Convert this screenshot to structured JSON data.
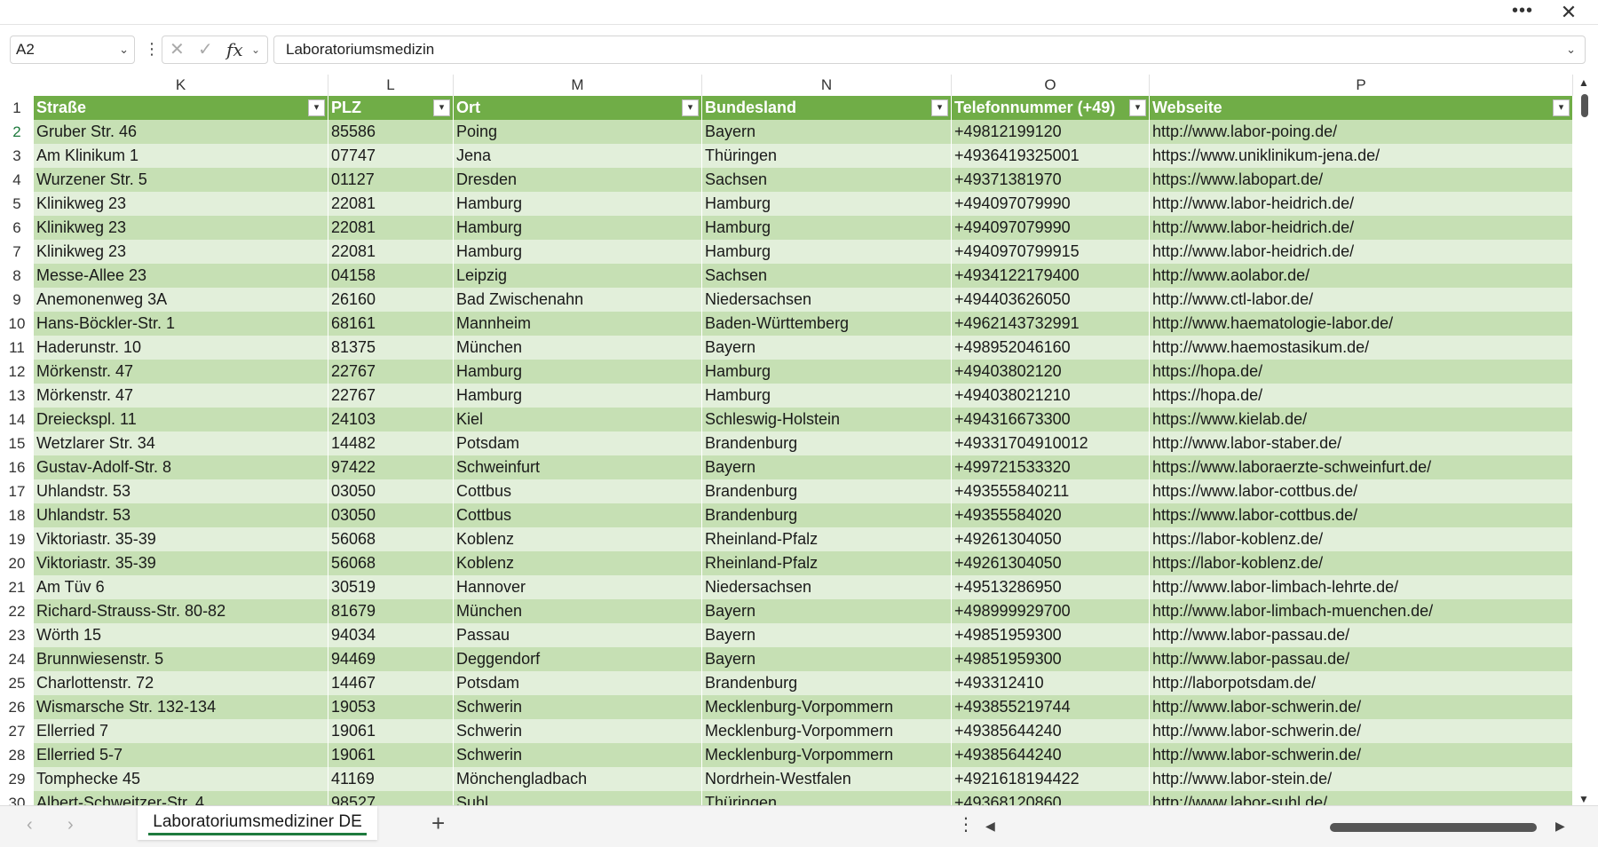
{
  "window": {
    "more_label": "•••",
    "close_label": "✕"
  },
  "formula_bar": {
    "name_box": "A2",
    "dots": "⋮",
    "cancel_icon": "✕",
    "enter_icon": "✓",
    "fx_label": "fx",
    "content": "Laboratoriumsmedizin"
  },
  "columns": [
    "K",
    "L",
    "M",
    "N",
    "O",
    "P"
  ],
  "header_row": {
    "number": "1",
    "cells": [
      "Straße",
      "PLZ",
      "Ort",
      "Bundesland",
      "Telefonnummer (+49)",
      "Webseite"
    ]
  },
  "rows": [
    {
      "n": "2",
      "cells": [
        "Gruber Str. 46",
        "85586",
        "Poing",
        "Bayern",
        "+49812199120",
        "http://www.labor-poing.de/"
      ]
    },
    {
      "n": "3",
      "cells": [
        "Am Klinikum 1",
        "07747",
        "Jena",
        "Thüringen",
        "+4936419325001",
        "https://www.uniklinikum-jena.de/"
      ]
    },
    {
      "n": "4",
      "cells": [
        "Wurzener Str. 5",
        "01127",
        "Dresden",
        "Sachsen",
        "+49371381970",
        "https://www.labopart.de/"
      ]
    },
    {
      "n": "5",
      "cells": [
        "Klinikweg 23",
        "22081",
        "Hamburg",
        "Hamburg",
        "+494097079990",
        "http://www.labor-heidrich.de/"
      ]
    },
    {
      "n": "6",
      "cells": [
        "Klinikweg 23",
        "22081",
        "Hamburg",
        "Hamburg",
        "+494097079990",
        "http://www.labor-heidrich.de/"
      ]
    },
    {
      "n": "7",
      "cells": [
        "Klinikweg 23",
        "22081",
        "Hamburg",
        "Hamburg",
        "+4940970799915",
        "http://www.labor-heidrich.de/"
      ]
    },
    {
      "n": "8",
      "cells": [
        "Messe-Allee 23",
        "04158",
        "Leipzig",
        "Sachsen",
        "+4934122179400",
        "http://www.aolabor.de/"
      ]
    },
    {
      "n": "9",
      "cells": [
        "Anemonenweg 3A",
        "26160",
        "Bad Zwischenahn",
        "Niedersachsen",
        "+494403626050",
        "http://www.ctl-labor.de/"
      ]
    },
    {
      "n": "10",
      "cells": [
        "Hans-Böckler-Str. 1",
        "68161",
        "Mannheim",
        "Baden-Württemberg",
        "+4962143732991",
        "http://www.haematologie-labor.de/"
      ]
    },
    {
      "n": "11",
      "cells": [
        "Haderunstr. 10",
        "81375",
        "München",
        "Bayern",
        "+498952046160",
        "http://www.haemostasikum.de/"
      ]
    },
    {
      "n": "12",
      "cells": [
        "Mörkenstr. 47",
        "22767",
        "Hamburg",
        "Hamburg",
        "+49403802120",
        "https://hopa.de/"
      ]
    },
    {
      "n": "13",
      "cells": [
        "Mörkenstr. 47",
        "22767",
        "Hamburg",
        "Hamburg",
        "+494038021210",
        "https://hopa.de/"
      ]
    },
    {
      "n": "14",
      "cells": [
        "Dreieckspl. 11",
        "24103",
        "Kiel",
        "Schleswig-Holstein",
        "+494316673300",
        "https://www.kielab.de/"
      ]
    },
    {
      "n": "15",
      "cells": [
        "Wetzlarer Str. 34",
        "14482",
        "Potsdam",
        "Brandenburg",
        "+49331704910012",
        "http://www.labor-staber.de/"
      ]
    },
    {
      "n": "16",
      "cells": [
        "Gustav-Adolf-Str. 8",
        "97422",
        "Schweinfurt",
        "Bayern",
        "+499721533320",
        "https://www.laboraerzte-schweinfurt.de/"
      ]
    },
    {
      "n": "17",
      "cells": [
        "Uhlandstr. 53",
        "03050",
        "Cottbus",
        "Brandenburg",
        "+493555840211",
        "https://www.labor-cottbus.de/"
      ]
    },
    {
      "n": "18",
      "cells": [
        "Uhlandstr. 53",
        "03050",
        "Cottbus",
        "Brandenburg",
        "+49355584020",
        "https://www.labor-cottbus.de/"
      ]
    },
    {
      "n": "19",
      "cells": [
        "Viktoriastr. 35-39",
        "56068",
        "Koblenz",
        "Rheinland-Pfalz",
        "+49261304050",
        "https://labor-koblenz.de/"
      ]
    },
    {
      "n": "20",
      "cells": [
        "Viktoriastr. 35-39",
        "56068",
        "Koblenz",
        "Rheinland-Pfalz",
        "+49261304050",
        "https://labor-koblenz.de/"
      ]
    },
    {
      "n": "21",
      "cells": [
        "Am Tüv 6",
        "30519",
        "Hannover",
        "Niedersachsen",
        "+49513286950",
        "http://www.labor-limbach-lehrte.de/"
      ]
    },
    {
      "n": "22",
      "cells": [
        "Richard-Strauss-Str. 80-82",
        "81679",
        "München",
        "Bayern",
        "+498999929700",
        "http://www.labor-limbach-muenchen.de/"
      ]
    },
    {
      "n": "23",
      "cells": [
        "Wörth 15",
        "94034",
        "Passau",
        "Bayern",
        "+49851959300",
        "http://www.labor-passau.de/"
      ]
    },
    {
      "n": "24",
      "cells": [
        "Brunnwiesenstr. 5",
        "94469",
        "Deggendorf",
        "Bayern",
        "+49851959300",
        "http://www.labor-passau.de/"
      ]
    },
    {
      "n": "25",
      "cells": [
        "Charlottenstr. 72",
        "14467",
        "Potsdam",
        "Brandenburg",
        "+493312410",
        "http://laborpotsdam.de/"
      ]
    },
    {
      "n": "26",
      "cells": [
        "Wismarsche Str. 132-134",
        "19053",
        "Schwerin",
        "Mecklenburg-Vorpommern",
        "+493855219744",
        "http://www.labor-schwerin.de/"
      ]
    },
    {
      "n": "27",
      "cells": [
        "Ellerried 7",
        "19061",
        "Schwerin",
        "Mecklenburg-Vorpommern",
        "+49385644240",
        "http://www.labor-schwerin.de/"
      ]
    },
    {
      "n": "28",
      "cells": [
        "Ellerried 5-7",
        "19061",
        "Schwerin",
        "Mecklenburg-Vorpommern",
        "+49385644240",
        "http://www.labor-schwerin.de/"
      ]
    },
    {
      "n": "29",
      "cells": [
        "Tomphecke 45",
        "41169",
        "Mönchengladbach",
        "Nordrhein-Westfalen",
        "+4921618194422",
        "http://www.labor-stein.de/"
      ]
    },
    {
      "n": "30",
      "cells": [
        "Albert-Schweitzer-Str. 4",
        "98527",
        "Suhl",
        "Thüringen",
        "+49368120860",
        "http://www.labor-suhl.de/"
      ]
    }
  ],
  "sheet_tabs": {
    "active": "Laboratoriumsmediziner DE",
    "add_label": "+"
  },
  "colors": {
    "header": "#70ad47",
    "band_dark": "#c6e0b4",
    "band_light": "#e2efda",
    "accent": "#1e7a3d"
  }
}
